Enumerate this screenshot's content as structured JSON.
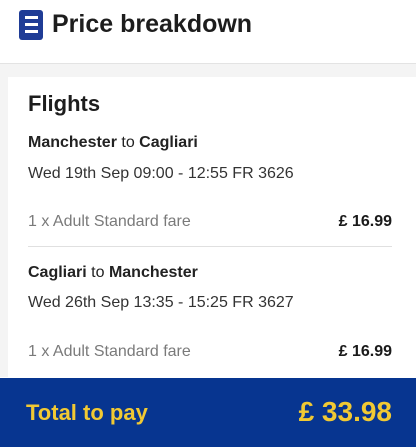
{
  "header": {
    "icon": "receipt-list-icon",
    "title": "Price breakdown"
  },
  "section": {
    "title": "Flights"
  },
  "flights": [
    {
      "origin": "Manchester",
      "connector": "to",
      "destination": "Cagliari",
      "datetime": "Wed 19th Sep 09:00 - 12:55 FR 3626",
      "fare_label": "1 x Adult Standard fare",
      "fare_price": "£ 16.99"
    },
    {
      "origin": "Cagliari",
      "connector": "to",
      "destination": "Manchester",
      "datetime": "Wed 26th Sep 13:35 - 15:25 FR 3627",
      "fare_label": "1 x Adult Standard fare",
      "fare_price": "£ 16.99"
    }
  ],
  "footer": {
    "label": "Total to pay",
    "value": "£ 33.98"
  },
  "colors": {
    "brand_blue": "#073590",
    "accent_yellow": "#f1c933",
    "icon_blue": "#1f3c96"
  }
}
